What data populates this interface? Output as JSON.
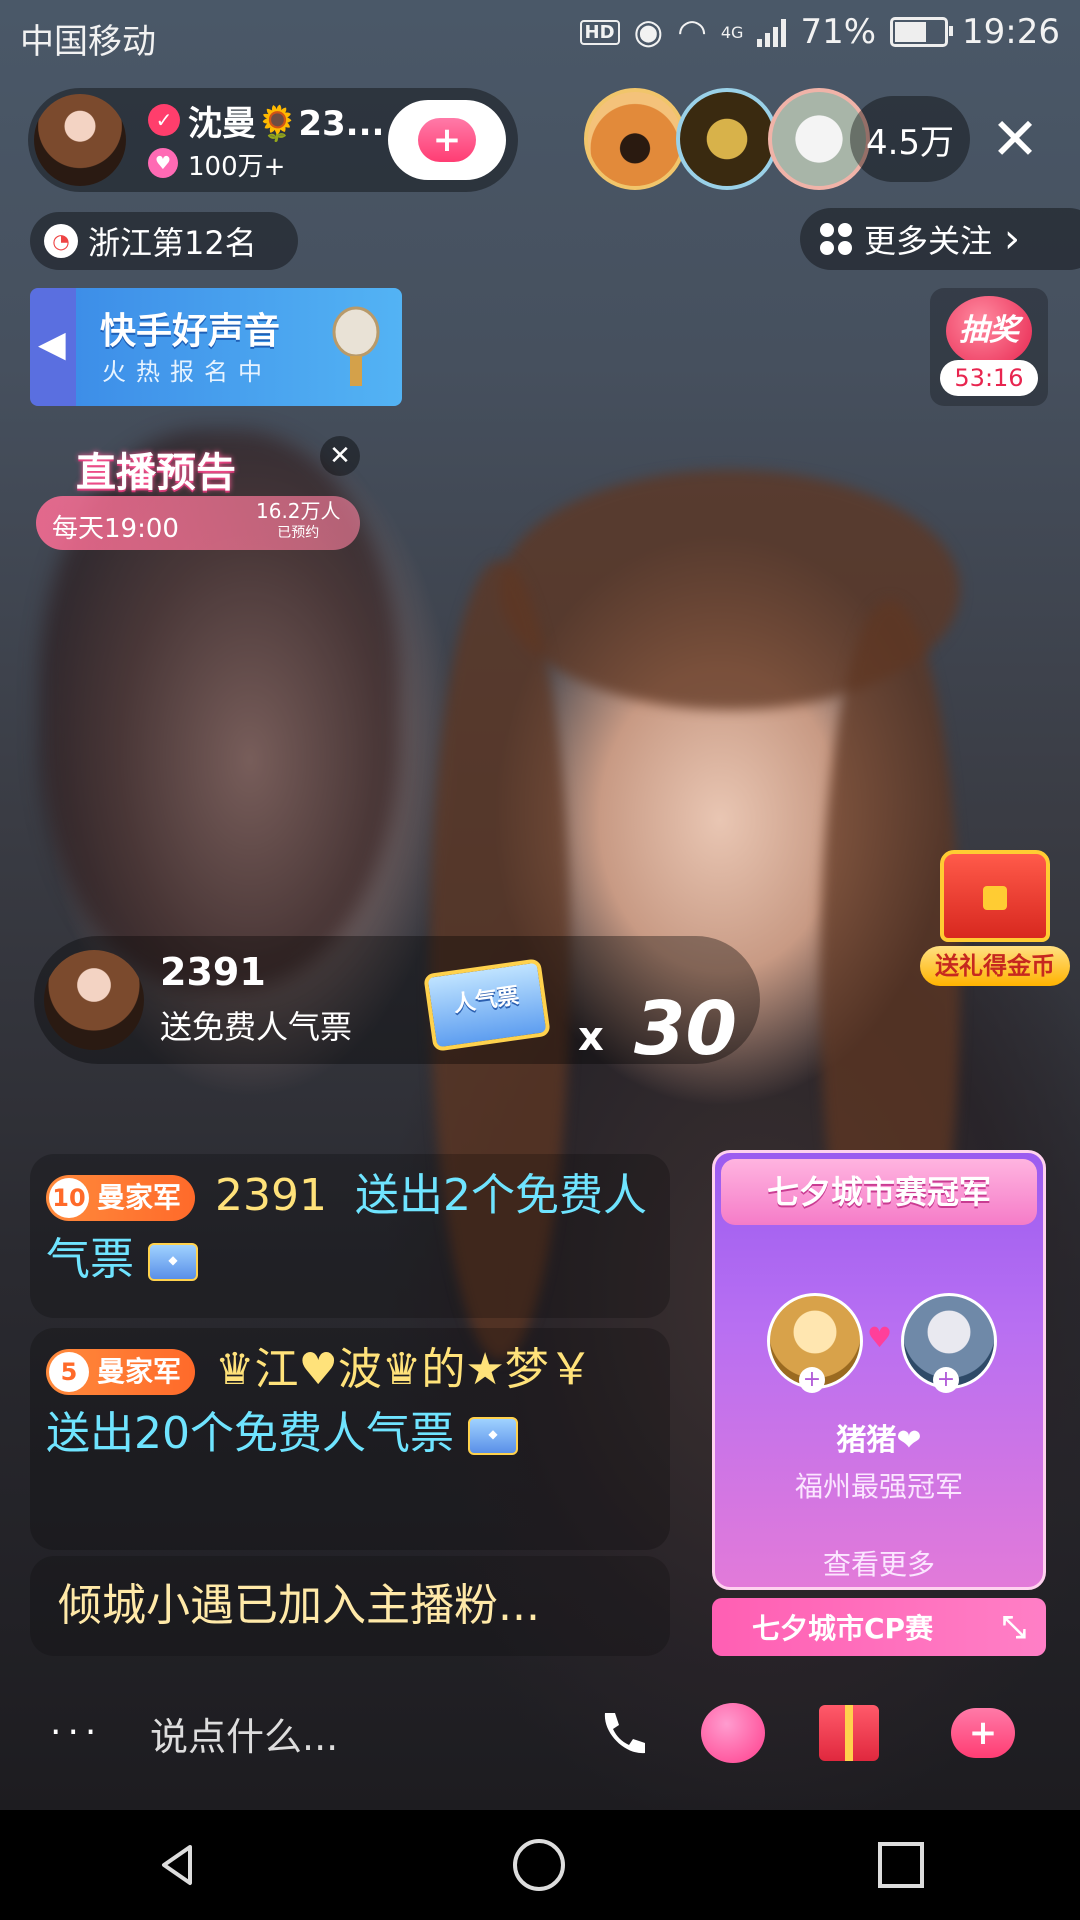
{
  "status": {
    "carrier": "中国移动",
    "hd": "HD",
    "network": "4G",
    "battery": "71%",
    "battery_level": 0.71,
    "time": "19:26"
  },
  "streamer": {
    "name": "沈曼🌻23...",
    "likes": "100万+"
  },
  "viewers": {
    "count": "4.5万"
  },
  "rank": {
    "label": "浙江第12名"
  },
  "more_follow": {
    "label": "更多关注",
    "chevron": "›"
  },
  "banner": {
    "title": "快手好声音",
    "subtitle": "火热报名中"
  },
  "lottery": {
    "label": "抽奖",
    "timer": "53:16"
  },
  "preview": {
    "title": "直播预告",
    "time": "每天19:00",
    "count": "16.2万人",
    "count_sub": "已预约"
  },
  "gift_notice": {
    "user": "2391",
    "desc": "送免费人气票",
    "item_label": "人气票",
    "x": "x",
    "times": "30"
  },
  "treasure": {
    "label": "送礼得金币"
  },
  "comments": [
    {
      "level": "10",
      "badge": "曼家军",
      "user": "2391",
      "action": "送出2个免费人气票"
    },
    {
      "level": "5",
      "badge": "曼家军",
      "user": "♛江♥波♛的★梦￥",
      "action": "送出20个免费人气票"
    }
  ],
  "join_line": "倾城小遇已加入主播粉...",
  "cp_card": {
    "title": "七夕城市赛冠军",
    "name": "猪猪❤",
    "subtitle": "福州最强冠军",
    "more": "查看更多",
    "plus": "+"
  },
  "cp_bar": {
    "label": "七夕城市CP赛"
  },
  "bottom": {
    "dots": "···",
    "input_placeholder": "说点什么..."
  },
  "icons": {
    "close": "✕",
    "heart_plus": "+",
    "phone": "📞"
  }
}
